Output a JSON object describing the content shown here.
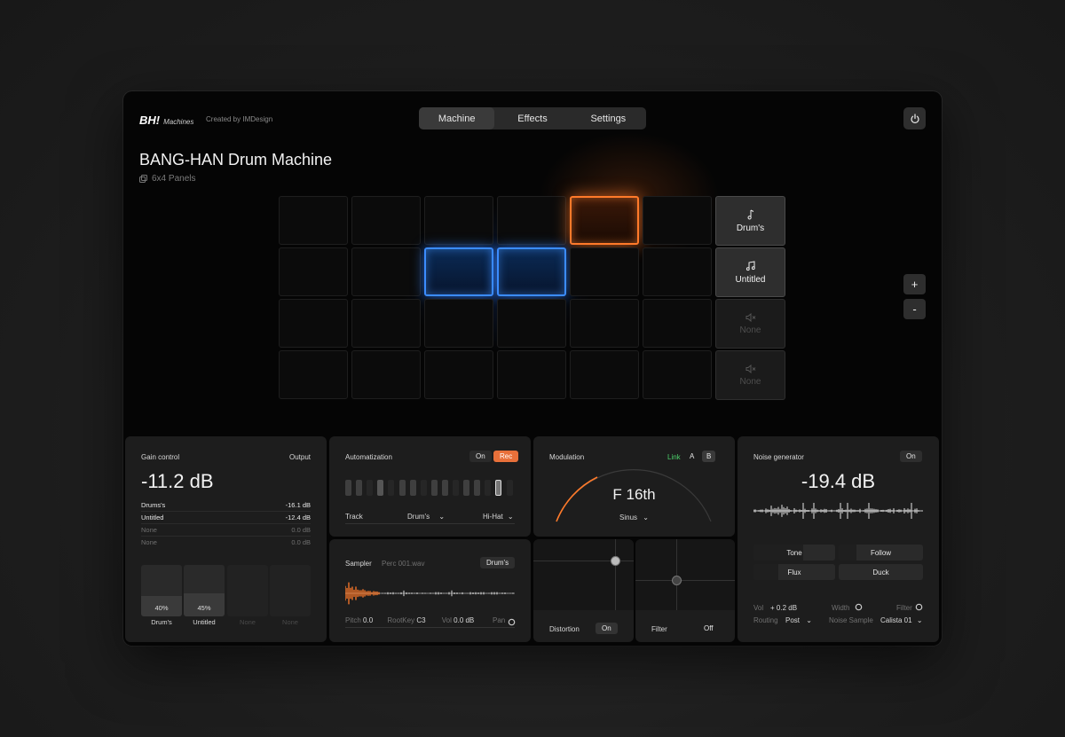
{
  "header": {
    "logo_mark": "BH!",
    "logo_sub": "Machines",
    "created_by": "Created by IMDesign",
    "tabs": [
      {
        "label": "Machine",
        "active": true
      },
      {
        "label": "Effects",
        "active": false
      },
      {
        "label": "Settings",
        "active": false
      }
    ],
    "power_icon": "power-icon"
  },
  "machine": {
    "title": "BANG-HAN Drum Machine",
    "subtitle": "6x4 Panels",
    "subtitle_icon": "copy-icon",
    "pads": {
      "rows": 4,
      "cols": 6,
      "active": [
        {
          "row": 0,
          "col": 4,
          "color": "#ff7a2a"
        },
        {
          "row": 1,
          "col": 2,
          "color": "#3b8cff"
        },
        {
          "row": 1,
          "col": 3,
          "color": "#3b8cff"
        }
      ]
    },
    "tracks": [
      {
        "label": "Drum's",
        "icon": "music-note-icon",
        "active": true
      },
      {
        "label": "Untitled",
        "icon": "music-notes-icon",
        "active": true
      },
      {
        "label": "None",
        "icon": "mute-icon",
        "active": false
      },
      {
        "label": "None",
        "icon": "mute-icon",
        "active": false
      }
    ],
    "zoom_in": "+",
    "zoom_out": "-"
  },
  "gain": {
    "title": "Gain control",
    "output_label": "Output",
    "value": "-11.2 dB",
    "rows": [
      {
        "name": "Drums's",
        "value": "-16.1 dB",
        "muted": false
      },
      {
        "name": "Untitled",
        "value": "-12.4 dB",
        "muted": false
      },
      {
        "name": "None",
        "value": "0.0 dB",
        "muted": true
      },
      {
        "name": "None",
        "value": "0.0 dB",
        "muted": true
      }
    ],
    "faders": [
      {
        "name": "Drum's",
        "percent": "40%",
        "level": 0.4,
        "muted": false
      },
      {
        "name": "Untitled",
        "percent": "45%",
        "level": 0.45,
        "muted": false
      },
      {
        "name": "None",
        "percent": "",
        "level": 0,
        "muted": true
      },
      {
        "name": "None",
        "percent": "",
        "level": 0,
        "muted": true
      }
    ]
  },
  "automation": {
    "title": "Automatization",
    "on_label": "On",
    "rec_label": "Rec",
    "rec_color": "#ff7a2a",
    "track_label": "Track",
    "track_value": "Drum's",
    "instrument_value": "Hi-Hat"
  },
  "modulation": {
    "title": "Modulation",
    "link_label": "Link",
    "link_color": "#4ccf6a",
    "a_label": "A",
    "b_label": "B",
    "value": "F 16th",
    "wave": "Sinus",
    "arc_color": "#ff7a2a"
  },
  "noise": {
    "title": "Noise generator",
    "on_label": "On",
    "value": "-19.4 dB",
    "buttons": {
      "tone": "Tone",
      "follow": "Follow",
      "flux": "Flux",
      "duck": "Duck"
    },
    "vol_label": "Vol",
    "vol_value": "+ 0.2 dB",
    "width_label": "Width",
    "filter_label": "Filter",
    "routing_label": "Routing",
    "routing_value": "Post",
    "sample_label": "Noise Sample",
    "sample_value": "Calista 01"
  },
  "sampler": {
    "title": "Sampler",
    "file": "Perc 001.wav",
    "track": "Drum's",
    "pitch_label": "Pitch",
    "pitch_value": "0.0",
    "rootkey_label": "RootKey",
    "rootkey_value": "C3",
    "vol_label": "Vol",
    "vol_value": "0.0 dB",
    "pan_label": "Pan",
    "wave_color": "#ff7a2a"
  },
  "distortion": {
    "label": "Distortion",
    "toggle": "On"
  },
  "filter": {
    "label": "Filter",
    "toggle": "Off"
  }
}
